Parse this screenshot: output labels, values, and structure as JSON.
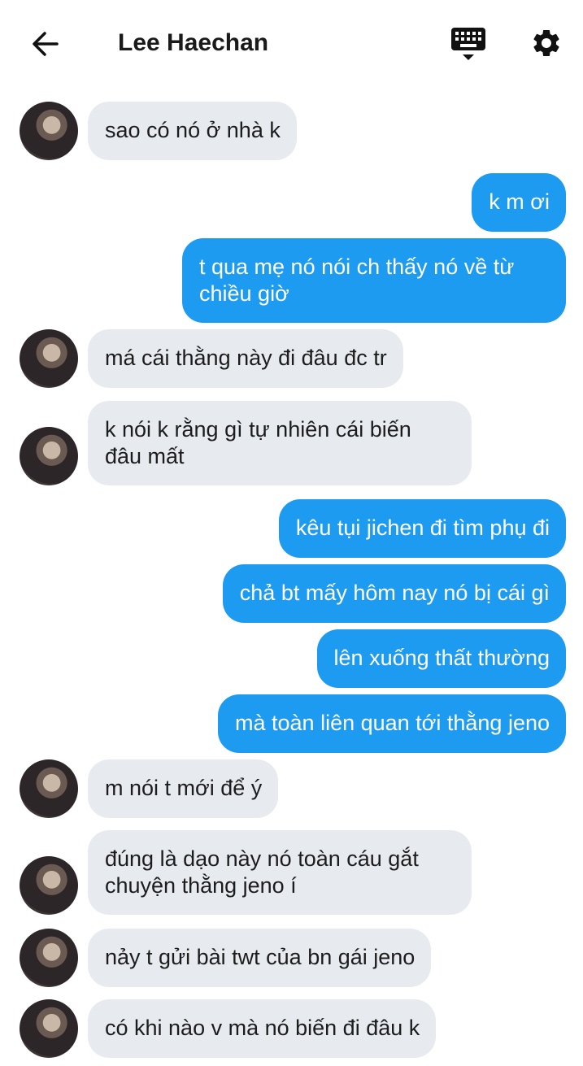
{
  "header": {
    "title": "Lee Haechan",
    "back_icon": "arrow-left-icon",
    "keyboard_icon": "keyboard-icon",
    "settings_icon": "gear-icon"
  },
  "colors": {
    "outgoing_bubble": "#1d9bf0",
    "incoming_bubble": "#e7ebf0"
  },
  "messages": [
    {
      "from": "them",
      "text": "sao có nó ở nhà k"
    },
    {
      "from": "me",
      "text": "k m ơi"
    },
    {
      "from": "me",
      "text": "t qua mẹ nó nói ch thấy nó về từ\nchiều giờ"
    },
    {
      "from": "them",
      "text": "má cái thằng này đi đâu đc tr"
    },
    {
      "from": "them",
      "text": "k nói k rằng gì tự nhiên cái biến\nđâu mất"
    },
    {
      "from": "me",
      "text": "kêu tụi jichen đi tìm phụ đi"
    },
    {
      "from": "me",
      "text": "chả bt mấy hôm nay nó bị cái gì"
    },
    {
      "from": "me",
      "text": "lên xuống thất thường"
    },
    {
      "from": "me",
      "text": "mà toàn liên quan tới thằng jeno"
    },
    {
      "from": "them",
      "text": "m nói t mới để ý"
    },
    {
      "from": "them",
      "text": "đúng là dạo này nó toàn cáu gắt\nchuyện thằng jeno í"
    },
    {
      "from": "them",
      "text": "nảy t gửi bài twt của bn gái jeno"
    },
    {
      "from": "them",
      "text": "có khi nào v mà nó biến đi đâu k"
    }
  ]
}
